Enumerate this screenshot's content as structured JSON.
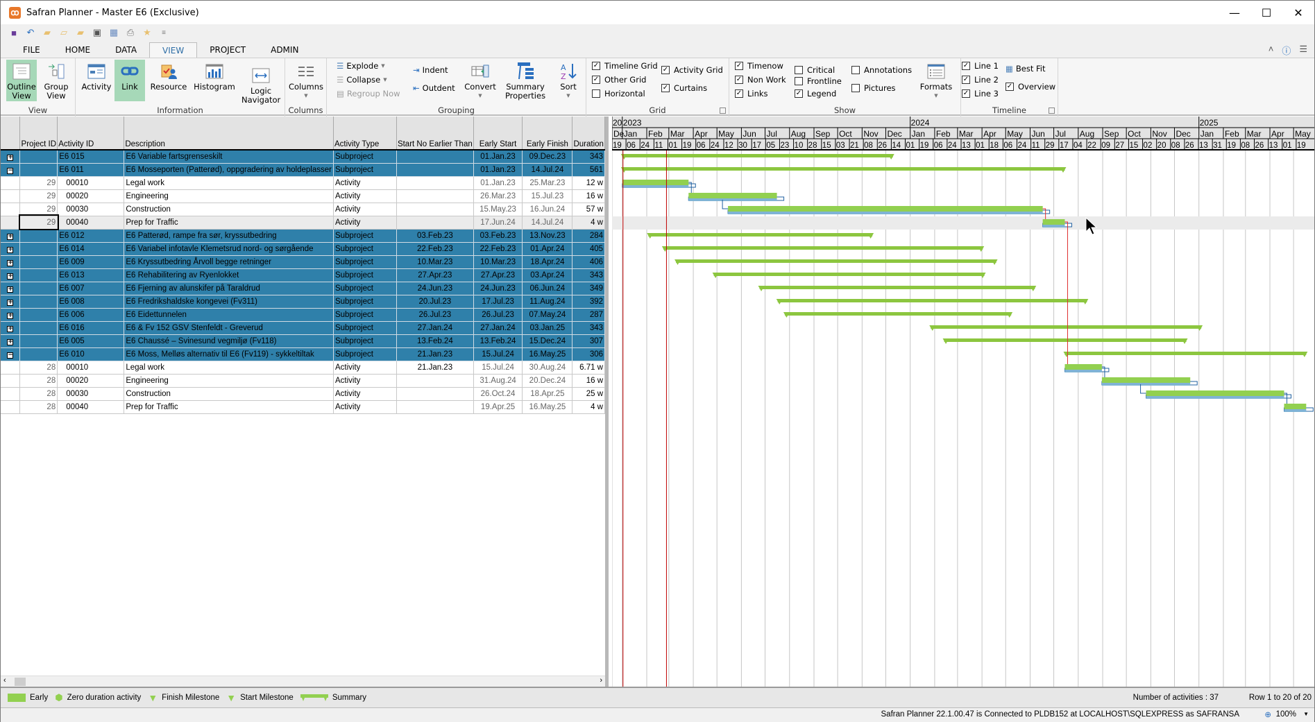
{
  "window": {
    "title": "Safran Planner - Master E6 (Exclusive)",
    "logo": "safran-logo"
  },
  "qat": [
    "save-icon",
    "undo-icon",
    "new-folder-icon",
    "open-folder-icon",
    "revert-folder-icon",
    "save-as-icon",
    "grid-icon",
    "print-preview-icon",
    "favorites-folder-icon",
    "customize-icon"
  ],
  "tabs": [
    {
      "label": "FILE"
    },
    {
      "label": "HOME"
    },
    {
      "label": "DATA"
    },
    {
      "label": "VIEW",
      "active": true
    },
    {
      "label": "PROJECT"
    },
    {
      "label": "ADMIN"
    }
  ],
  "ribbon": {
    "view": {
      "label": "View",
      "outline": "Outline View",
      "group": "Group View"
    },
    "information": {
      "label": "Information",
      "activity": "Activity",
      "link": "Link",
      "resource": "Resource",
      "histogram": "Histogram",
      "logic": "Logic Navigator"
    },
    "columns": {
      "label": "Columns",
      "btn": "Columns"
    },
    "grouping": {
      "label": "Grouping",
      "explode": "Explode",
      "collapse": "Collapse",
      "regroup": "Regroup Now",
      "indent": "Indent",
      "outdent": "Outdent",
      "convert": "Convert",
      "summary": "Summary Properties",
      "sort": "Sort"
    },
    "grid": {
      "label": "Grid",
      "items": [
        {
          "label": "Timeline Grid",
          "checked": true
        },
        {
          "label": "Other Grid",
          "checked": true
        },
        {
          "label": "Horizontal",
          "checked": false
        },
        {
          "label": "Activity Grid",
          "checked": true
        },
        {
          "label": "Curtains",
          "checked": true
        }
      ]
    },
    "show": {
      "label": "Show",
      "items": [
        {
          "label": "Timenow",
          "checked": true
        },
        {
          "label": "Non Work",
          "checked": true
        },
        {
          "label": "Links",
          "checked": true
        },
        {
          "label": "Critical",
          "checked": false
        },
        {
          "label": "Frontline",
          "checked": false
        },
        {
          "label": "Legend",
          "checked": true
        },
        {
          "label": "Annotations",
          "checked": false
        },
        {
          "label": "Pictures",
          "checked": false
        }
      ],
      "formats": "Formats"
    },
    "timeline": {
      "label": "Timeline",
      "items": [
        {
          "label": "Line 1",
          "checked": true
        },
        {
          "label": "Line 2",
          "checked": true
        },
        {
          "label": "Line 3",
          "checked": true
        },
        {
          "label": "Overview",
          "checked": true
        }
      ],
      "bestfit": "Best Fit"
    }
  },
  "table": {
    "columns": [
      "",
      "Project ID",
      "Activity ID",
      "Description",
      "Activity Type",
      "Start No Earlier Than",
      "Early Start",
      "Early Finish",
      "Duration"
    ],
    "rows": [
      {
        "kind": "sub",
        "exp": "+",
        "pid": "",
        "aid": "E6 015",
        "desc": "E6 Variable fartsgrenseskilt",
        "type": "Subproject",
        "snet": "",
        "es": "01.Jan.23",
        "ef": "09.Dec.23",
        "dur": "343"
      },
      {
        "kind": "sub",
        "exp": "−",
        "pid": "",
        "aid": "E6 011",
        "desc": "E6 Mosseporten (Patterød), oppgradering av holdeplasser",
        "type": "Subproject",
        "snet": "",
        "es": "01.Jan.23",
        "ef": "14.Jul.24",
        "dur": "561"
      },
      {
        "kind": "act",
        "exp": "",
        "pid": "29",
        "aid": "00010",
        "desc": "Legal work",
        "type": "Activity",
        "snet": "",
        "es": "01.Jan.23",
        "ef": "25.Mar.23",
        "dur": "12 w"
      },
      {
        "kind": "act",
        "exp": "",
        "pid": "29",
        "aid": "00020",
        "desc": "Engineering",
        "type": "Activity",
        "snet": "",
        "es": "26.Mar.23",
        "ef": "15.Jul.23",
        "dur": "16 w"
      },
      {
        "kind": "act",
        "exp": "",
        "pid": "29",
        "aid": "00030",
        "desc": "Construction",
        "type": "Activity",
        "snet": "",
        "es": "15.May.23",
        "ef": "16.Jun.24",
        "dur": "57 w"
      },
      {
        "kind": "sel",
        "exp": "",
        "pid": "29",
        "aid": "00040",
        "desc": "Prep for Traffic",
        "type": "Activity",
        "snet": "",
        "es": "17.Jun.24",
        "ef": "14.Jul.24",
        "dur": "4 w"
      },
      {
        "kind": "sub",
        "exp": "+",
        "pid": "",
        "aid": "E6 012",
        "desc": "E6 Patterød, rampe fra sør, kryssutbedring",
        "type": "Subproject",
        "snet": "03.Feb.23",
        "es": "03.Feb.23",
        "ef": "13.Nov.23",
        "dur": "284"
      },
      {
        "kind": "sub",
        "exp": "+",
        "pid": "",
        "aid": "E6 014",
        "desc": "E6 Variabel infotavle Klemetsrud nord- og sørgående",
        "type": "Subproject",
        "snet": "22.Feb.23",
        "es": "22.Feb.23",
        "ef": "01.Apr.24",
        "dur": "405"
      },
      {
        "kind": "sub",
        "exp": "+",
        "pid": "",
        "aid": "E6 009",
        "desc": "E6 Kryssutbedring Årvoll begge retninger",
        "type": "Subproject",
        "snet": "10.Mar.23",
        "es": "10.Mar.23",
        "ef": "18.Apr.24",
        "dur": "406"
      },
      {
        "kind": "sub",
        "exp": "+",
        "pid": "",
        "aid": "E6 013",
        "desc": "E6 Rehabilitering av Ryenlokket",
        "type": "Subproject",
        "snet": "27.Apr.23",
        "es": "27.Apr.23",
        "ef": "03.Apr.24",
        "dur": "343"
      },
      {
        "kind": "sub",
        "exp": "+",
        "pid": "",
        "aid": "E6 007",
        "desc": "E6 Fjerning av alunskifer på Taraldrud",
        "type": "Subproject",
        "snet": "24.Jun.23",
        "es": "24.Jun.23",
        "ef": "06.Jun.24",
        "dur": "349"
      },
      {
        "kind": "sub",
        "exp": "+",
        "pid": "",
        "aid": "E6 008",
        "desc": "E6 Fredrikshaldske kongevei (Fv311)",
        "type": "Subproject",
        "snet": "20.Jul.23",
        "es": "17.Jul.23",
        "ef": "11.Aug.24",
        "dur": "392"
      },
      {
        "kind": "sub",
        "exp": "+",
        "pid": "",
        "aid": "E6 006",
        "desc": "E6 Eidettunnelen",
        "type": "Subproject",
        "snet": "26.Jul.23",
        "es": "26.Jul.23",
        "ef": "07.May.24",
        "dur": "287"
      },
      {
        "kind": "sub",
        "exp": "+",
        "pid": "",
        "aid": "E6 016",
        "desc": "E6 & Fv 152 GSV Stenfeldt - Greverud",
        "type": "Subproject",
        "snet": "27.Jan.24",
        "es": "27.Jan.24",
        "ef": "03.Jan.25",
        "dur": "343"
      },
      {
        "kind": "sub",
        "exp": "+",
        "pid": "",
        "aid": "E6 005",
        "desc": "E6 Chaussé – Svinesund vegmiljø (Fv118)",
        "type": "Subproject",
        "snet": "13.Feb.24",
        "es": "13.Feb.24",
        "ef": "15.Dec.24",
        "dur": "307"
      },
      {
        "kind": "sub",
        "exp": "−",
        "pid": "",
        "aid": "E6 010",
        "desc": "E6 Moss, Melløs alternativ til E6 (Fv119) - sykkeltiltak",
        "type": "Subproject",
        "snet": "21.Jan.23",
        "es": "15.Jul.24",
        "ef": "16.May.25",
        "dur": "306"
      },
      {
        "kind": "act",
        "exp": "",
        "pid": "28",
        "aid": "00010",
        "desc": "Legal work",
        "type": "Activity",
        "snet": "21.Jan.23",
        "es": "15.Jul.24",
        "ef": "30.Aug.24",
        "dur": "6.71 w"
      },
      {
        "kind": "act",
        "exp": "",
        "pid": "28",
        "aid": "00020",
        "desc": "Engineering",
        "type": "Activity",
        "snet": "",
        "es": "31.Aug.24",
        "ef": "20.Dec.24",
        "dur": "16 w"
      },
      {
        "kind": "act",
        "exp": "",
        "pid": "28",
        "aid": "00030",
        "desc": "Construction",
        "type": "Activity",
        "snet": "",
        "es": "26.Oct.24",
        "ef": "18.Apr.25",
        "dur": "25 w"
      },
      {
        "kind": "act",
        "exp": "",
        "pid": "28",
        "aid": "00040",
        "desc": "Prep for Traffic",
        "type": "Activity",
        "snet": "",
        "es": "19.Apr.25",
        "ef": "16.May.25",
        "dur": "4 w"
      }
    ]
  },
  "gantt": {
    "years": [
      "20",
      "2023",
      "2024",
      "2025"
    ],
    "months": [
      "De",
      "Jan",
      "Feb",
      "Mar",
      "Apr",
      "May",
      "Jun",
      "Jul",
      "Aug",
      "Sep",
      "Oct",
      "Nov",
      "Dec",
      "Jan",
      "Feb",
      "Mar",
      "Apr",
      "May",
      "Jun",
      "Jul",
      "Aug",
      "Sep",
      "Oct",
      "Nov",
      "Dec",
      "Jan",
      "Feb",
      "Mar",
      "Apr",
      "May"
    ],
    "weeks": [
      "19",
      "06",
      "24",
      "11",
      "01",
      "19",
      "06",
      "24",
      "12",
      "30",
      "17",
      "05",
      "23",
      "10",
      "28",
      "15",
      "03",
      "21",
      "08",
      "26",
      "14",
      "01",
      "19",
      "06",
      "24",
      "13",
      "01",
      "18",
      "06",
      "24",
      "11",
      "29",
      "17",
      "04",
      "22",
      "09",
      "27",
      "15",
      "02",
      "20",
      "08",
      "26",
      "13",
      "31",
      "19",
      "08",
      "26",
      "13",
      "01",
      "19"
    ],
    "timenow": "01.Jan.23",
    "colors": {
      "summary": "#8cc63f",
      "bar": "#92d050",
      "baseline": "#7fb3d5",
      "link": "#2060a0",
      "critical_link": "#e03030",
      "timenow": "#c00000"
    }
  },
  "legend": [
    {
      "icon": "early-bar",
      "label": "Early"
    },
    {
      "icon": "zero-duration-icon",
      "label": "Zero duration activity"
    },
    {
      "icon": "finish-milestone-icon",
      "label": "Finish Milestone"
    },
    {
      "icon": "start-milestone-icon",
      "label": "Start Milestone"
    },
    {
      "icon": "summary-bar",
      "label": "Summary"
    }
  ],
  "footer": {
    "count": "Number of activities : 37",
    "rows": "Row 1 to 20 of 20"
  },
  "status": {
    "text": "Safran Planner 22.1.00.47 is Connected to PLDB152 at LOCALHOST\\SQLEXPRESS as SAFRANSA",
    "zoom": "100%"
  }
}
